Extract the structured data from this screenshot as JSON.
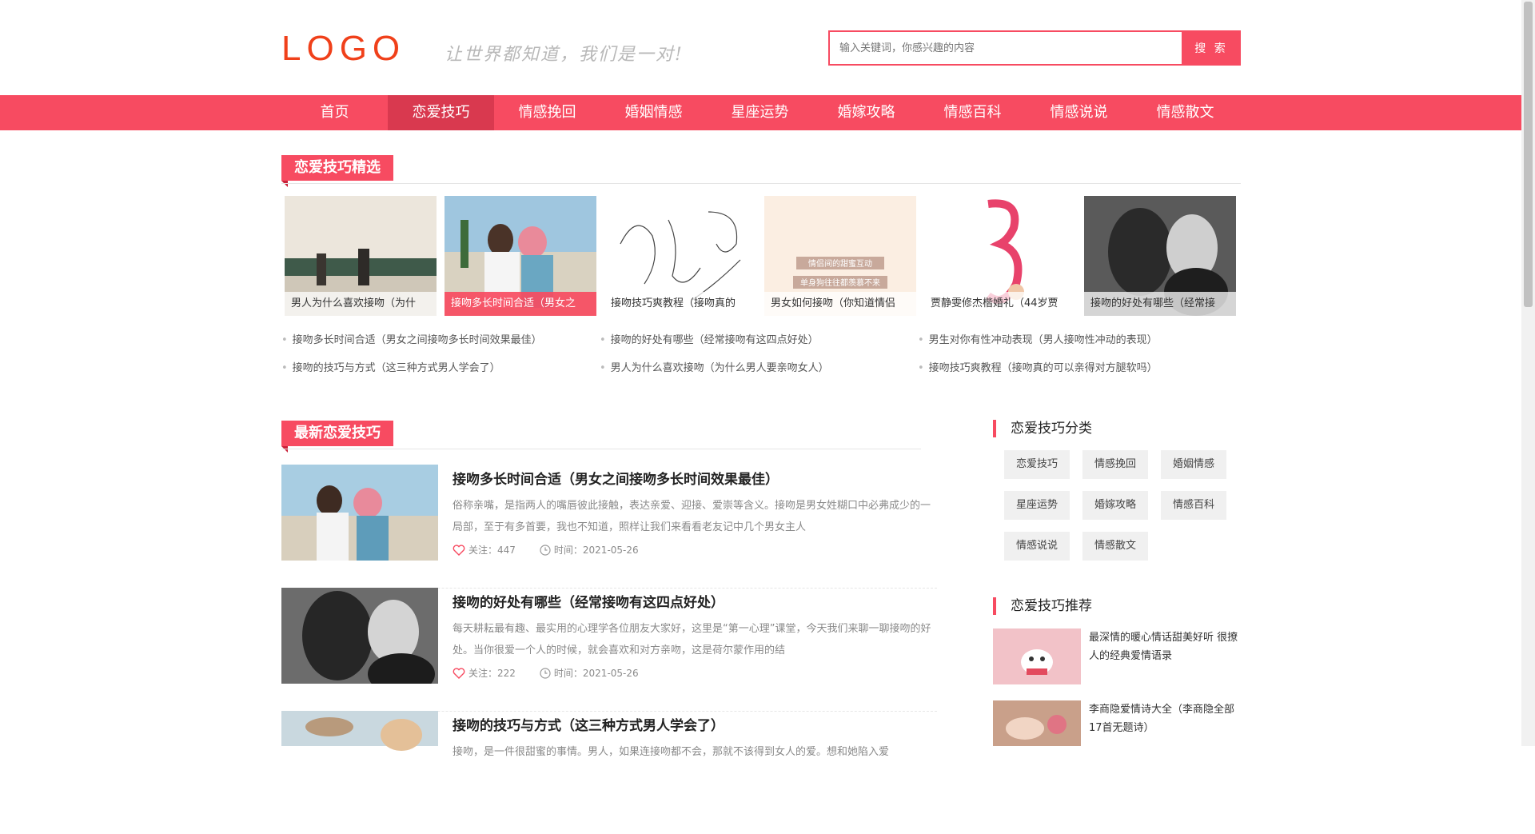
{
  "header": {
    "logo": "LOGO",
    "slogan": "让世界都知道，我们是一对!",
    "search_placeholder": "输入关键词，你感兴趣的内容",
    "search_button": "搜 索"
  },
  "nav": [
    {
      "label": "首页",
      "active": false
    },
    {
      "label": "恋爱技巧",
      "active": true
    },
    {
      "label": "情感挽回",
      "active": false
    },
    {
      "label": "婚姻情感",
      "active": false
    },
    {
      "label": "星座运势",
      "active": false
    },
    {
      "label": "婚嫁攻略",
      "active": false
    },
    {
      "label": "情感百科",
      "active": false
    },
    {
      "label": "情感说说",
      "active": false
    },
    {
      "label": "情感散文",
      "active": false
    }
  ],
  "featured": {
    "title": "恋爱技巧精选",
    "items": [
      "男人为什么喜欢接吻（为什",
      "接吻多长时间合适（男女之",
      "接吻技巧爽教程（接吻真的",
      "男女如何接吻（你知道情侣",
      "贾静雯修杰楷婚礼（44岁贾",
      "接吻的好处有哪些（经常接"
    ],
    "featured_text_in_image": [
      "情侣间的甜蜜互动",
      "单身狗往往都羡慕不来"
    ],
    "links": [
      "接吻多长时间合适（男女之间接吻多长时间效果最佳）",
      "接吻的好处有哪些（经常接吻有这四点好处）",
      "男生对你有性冲动表现（男人接吻性冲动的表现）",
      "接吻的技巧与方式（这三种方式男人学会了）",
      "男人为什么喜欢接吻（为什么男人要亲吻女人）",
      "接吻技巧爽教程（接吻真的可以亲得对方腿软吗）"
    ]
  },
  "latest": {
    "title": "最新恋爱技巧",
    "articles": [
      {
        "title": "接吻多长时间合适（男女之间接吻多长时间效果最佳）",
        "desc": "俗称亲嘴，是指两人的嘴唇彼此接触，表达亲爱、迎接、爱崇等含义。接吻是男女姓糊口中必弗成少的一局部，至于有多首要，我也不知道，照样让我们来看看老友记中几个男女主人",
        "likes": "关注：447",
        "time": "时间：2021-05-26"
      },
      {
        "title": "接吻的好处有哪些（经常接吻有这四点好处）",
        "desc": "每天耕耘最有趣、最实用的心理学各位朋友大家好，这里是“第一心理”课堂，今天我们来聊一聊接吻的好处。当你很爱一个人的时候，就会喜欢和对方亲吻，这是荷尔蒙作用的结",
        "likes": "关注：222",
        "time": "时间：2021-05-26"
      },
      {
        "title": "接吻的技巧与方式（这三种方式男人学会了）",
        "desc": "接吻，是一件很甜蜜的事情。男人，如果连接吻都不会，那就不该得到女人的爱。想和她陷入爱",
        "likes": "",
        "time": ""
      }
    ]
  },
  "sidebar": {
    "cat_title": "恋爱技巧分类",
    "cats": [
      "恋爱技巧",
      "情感挽回",
      "婚姻情感",
      "星座运势",
      "婚嫁攻略",
      "情感百科",
      "情感说说",
      "情感散文"
    ],
    "rec_title": "恋爱技巧推荐",
    "recs": [
      "最深情的暖心情话甜美好听 很撩人的经典爱情语录",
      "李商隐爱情诗大全（李商隐全部17首无题诗）"
    ]
  },
  "colors": {
    "accent": "#f74b61",
    "accent_dark": "#d9394f",
    "logo": "#f0401a"
  }
}
